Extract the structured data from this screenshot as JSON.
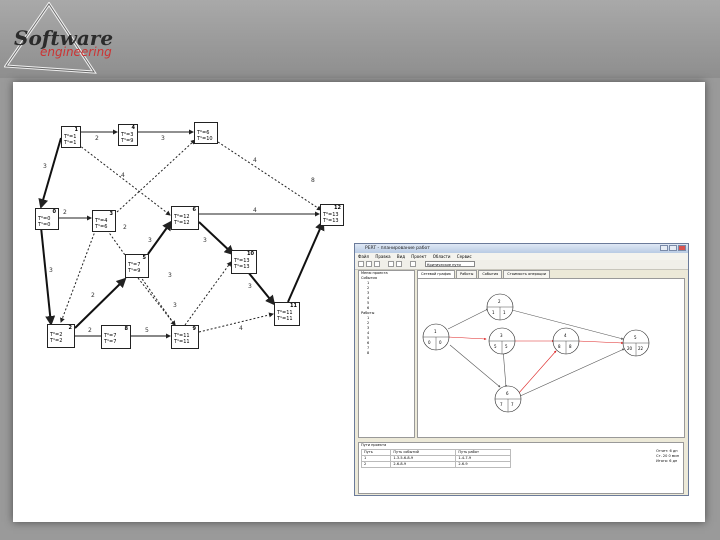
{
  "logo": {
    "line1": "Software",
    "line2": "engineering"
  },
  "diagram": {
    "nodes": [
      {
        "id": "n1",
        "num": "1",
        "lines": [
          "T⁰=1",
          "T¹=1"
        ]
      },
      {
        "id": "n4",
        "num": "4",
        "lines": [
          "T⁰=3",
          "T¹=9"
        ]
      },
      {
        "id": "n7",
        "num": "",
        "lines": [
          "T⁰=6",
          "T¹=10"
        ]
      },
      {
        "id": "n0",
        "num": "0",
        "lines": [
          "T⁰=0",
          "T¹=0"
        ]
      },
      {
        "id": "n3",
        "num": "3",
        "lines": [
          "T⁰=4",
          "T¹=6"
        ]
      },
      {
        "id": "n6",
        "num": "6",
        "lines": [
          "T⁰=12",
          "T¹=12"
        ]
      },
      {
        "id": "n12",
        "num": "12",
        "lines": [
          "T⁰=13",
          "T¹=13"
        ]
      },
      {
        "id": "n10",
        "num": "10",
        "lines": [
          "T⁰=13",
          "T¹=13"
        ]
      },
      {
        "id": "n5",
        "num": "5",
        "lines": [
          "T⁰=7",
          "T¹=9"
        ]
      },
      {
        "id": "n2",
        "num": "2",
        "lines": [
          "T⁰=2",
          "T¹=2"
        ]
      },
      {
        "id": "n8",
        "num": "8",
        "lines": [
          "T⁰=7",
          "T¹=7"
        ]
      },
      {
        "id": "n9",
        "num": "9",
        "lines": [
          "T⁰=11",
          "T¹=11"
        ]
      },
      {
        "id": "n11",
        "num": "11",
        "lines": [
          "T⁰=11",
          "T¹=11"
        ]
      }
    ],
    "edge_labels": [
      "2",
      "3",
      "4",
      "3",
      "2",
      "4",
      "2",
      "3",
      "3",
      "3",
      "3",
      "2",
      "5",
      "4",
      "2",
      "8",
      "3",
      "4",
      "3"
    ]
  },
  "app": {
    "title": "PERT - планирование работ",
    "menu": [
      "Файл",
      "Правка",
      "Вид",
      "Проект",
      "Области",
      "Сервис"
    ],
    "combo": "Критические пути",
    "tabs": [
      "Сетевой график",
      "Работы",
      "События",
      "Стоимость операции"
    ],
    "tree_title": "Меню проекта",
    "tree_items": [
      "События",
      "1",
      "2",
      "3",
      "4",
      "5",
      "6",
      "Работы",
      "1",
      "2",
      "3",
      "4",
      "5",
      "6",
      "7",
      "8"
    ],
    "bottom_title": "Пути проекта",
    "table_headers": [
      "Путь",
      "Путь событий",
      "Путь работ"
    ],
    "table_rows": [
      [
        "1",
        "1-3-5-6-8-9",
        "1-4-7-9"
      ],
      [
        "2",
        "2-6-8-9",
        "2-6-9"
      ]
    ],
    "side_info": [
      "Отчет: 6 дн",
      "Ст. 20 0 мин",
      "Итого: 6 дн"
    ],
    "graph_nodes": [
      {
        "id": "g1",
        "t": "1",
        "l": "0",
        "r": "0"
      },
      {
        "id": "g2",
        "t": "2",
        "l": "1",
        "r": "1"
      },
      {
        "id": "g3",
        "t": "3",
        "l": "5",
        "r": "5"
      },
      {
        "id": "g4",
        "t": "4",
        "l": "8",
        "r": "8"
      },
      {
        "id": "g5",
        "t": "5",
        "l": "20",
        "r": "22"
      },
      {
        "id": "g6",
        "t": "6",
        "l": "7",
        "r": "7"
      }
    ]
  }
}
